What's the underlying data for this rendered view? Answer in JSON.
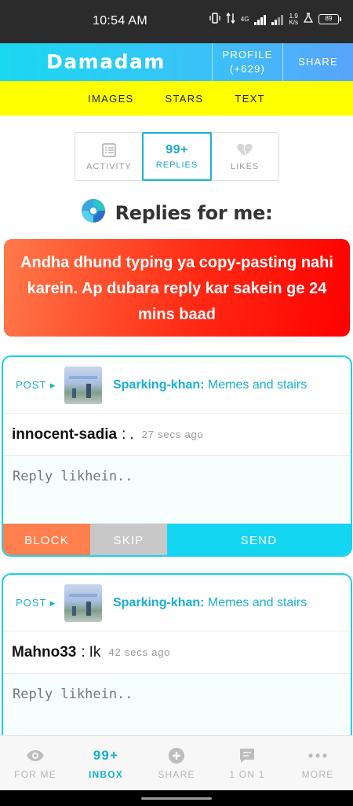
{
  "status_bar": {
    "time": "10:54 AM",
    "network_type": "4G",
    "speed": "1.9",
    "speed_unit": "K/s",
    "battery": "89",
    "icons": [
      "vibrate-icon",
      "data-arrows-icon",
      "signal-icon",
      "signal-icon",
      "lab-icon",
      "battery-icon"
    ]
  },
  "header": {
    "brand": "Damadam",
    "profile_label": "PROFILE",
    "profile_points": "(+629)",
    "share_label": "SHARE"
  },
  "subnav": {
    "items": [
      "IMAGES",
      "STARS",
      "TEXT"
    ]
  },
  "tabs": [
    {
      "label": "ACTIVITY",
      "icon": "list-icon"
    },
    {
      "label": "REPLIES",
      "count": "99+",
      "active": true
    },
    {
      "label": "LIKES",
      "icon": "heart-icon"
    }
  ],
  "replies_title": "Replies for me:",
  "warning": "Andha dhund typing ya copy-pasting nahi karein. Ap dubara reply kar sakein ge 24 mins baad",
  "cards": [
    {
      "post_label": "POST ▸",
      "post_author": "Sparking-khan:",
      "post_title": "Memes and stairs",
      "author": "innocent-sadia",
      "colon": ":",
      "message": ".",
      "time_ago": "27 secs ago",
      "reply_placeholder": "Reply likhein..",
      "block_label": "BLOCK",
      "skip_label": "SKIP",
      "send_label": "SEND"
    },
    {
      "post_label": "POST ▸",
      "post_author": "Sparking-khan:",
      "post_title": "Memes and stairs",
      "author": "Mahno33",
      "colon": ":",
      "message": "Ik",
      "time_ago": "42 secs ago",
      "reply_placeholder": "Reply likhein.."
    }
  ],
  "bottom_nav": [
    {
      "label": "FOR ME",
      "icon": "eye-icon"
    },
    {
      "label": "INBOX",
      "count": "99+",
      "active": true
    },
    {
      "label": "SHARE",
      "icon": "plus-circle-icon"
    },
    {
      "label": "1 ON 1",
      "icon": "chat-icon"
    },
    {
      "label": "MORE",
      "icon": "dots-icon"
    }
  ],
  "colors": {
    "accent": "#19b3d1",
    "header_start": "#1ad8f0",
    "header_end": "#5aa4fb",
    "subnav": "#ffff00",
    "warning": "#ff2a14",
    "block": "#ff7f4f",
    "skip": "#c7c7c7",
    "send": "#14d6f3"
  }
}
